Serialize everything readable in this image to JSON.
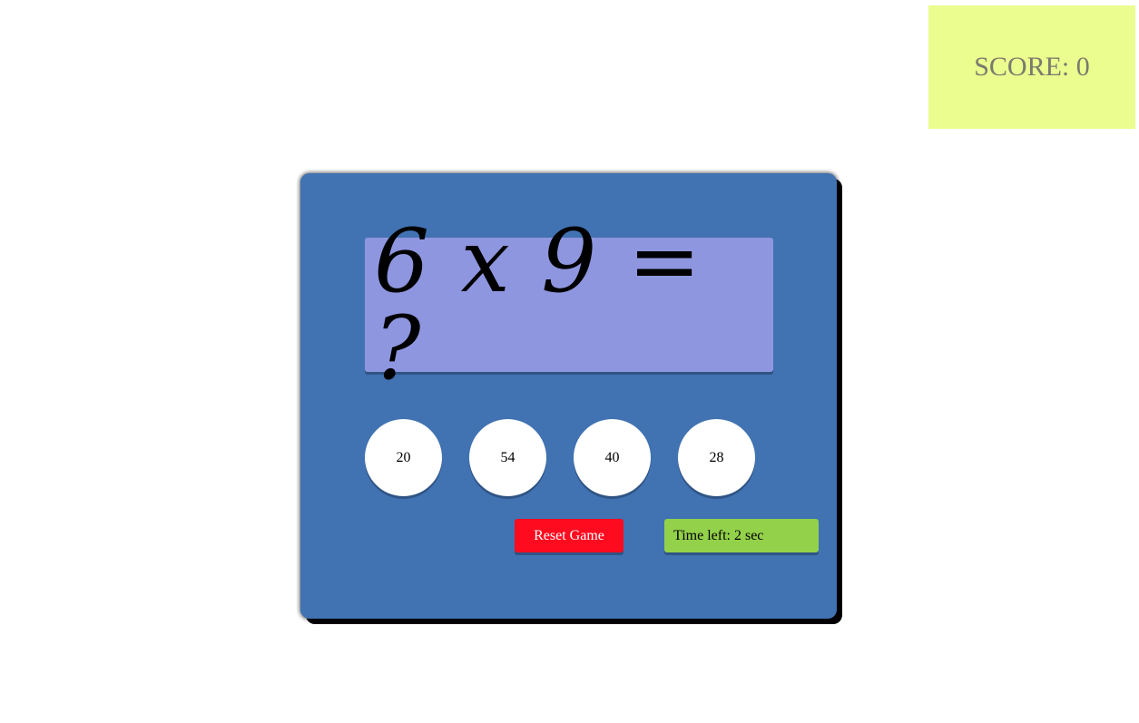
{
  "score": {
    "text": "SCORE: 0"
  },
  "question": {
    "text": "6 x 9 = ?"
  },
  "choices": [
    "20",
    "54",
    "40",
    "28"
  ],
  "controls": {
    "reset_label": "Reset Game",
    "timer_text": "Time left: 2 sec"
  },
  "colors": {
    "score_bg": "#ebfd8e",
    "board_bg": "#4172b2",
    "question_bg": "#8f96e0",
    "reset_bg": "#fe0b1f",
    "timer_bg": "#93d14a"
  }
}
